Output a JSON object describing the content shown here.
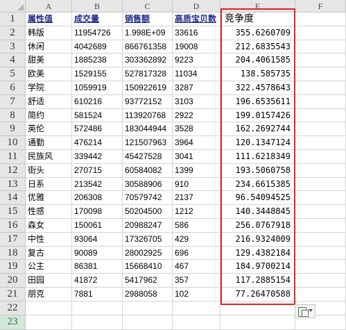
{
  "columns": [
    "A",
    "B",
    "C",
    "D",
    "E",
    "F"
  ],
  "rows": [
    "1",
    "2",
    "3",
    "4",
    "5",
    "6",
    "7",
    "8",
    "9",
    "10",
    "11",
    "12",
    "13",
    "14",
    "15",
    "16",
    "17",
    "18",
    "19",
    "20",
    "21",
    "22",
    "23"
  ],
  "headers": {
    "a": "属性值",
    "b": "成交量",
    "c": "销售额",
    "d": "高质宝贝数",
    "e": "竞争度"
  },
  "data": [
    {
      "a": "韩版",
      "b": "11954726",
      "c": "1.998E+09",
      "d": "33616",
      "e": "355.6260709"
    },
    {
      "a": "休闲",
      "b": "4042689",
      "c": "866761358",
      "d": "19008",
      "e": "212.6835543"
    },
    {
      "a": "甜美",
      "b": "1885238",
      "c": "303362892",
      "d": "9223",
      "e": "204.4061585"
    },
    {
      "a": "欧美",
      "b": "1529155",
      "c": "527817328",
      "d": "11034",
      "e": "138.585735"
    },
    {
      "a": "学院",
      "b": "1059919",
      "c": "150922619",
      "d": "3287",
      "e": "322.4578643"
    },
    {
      "a": "舒适",
      "b": "610216",
      "c": "93772152",
      "d": "3103",
      "e": "196.6535611"
    },
    {
      "a": "简约",
      "b": "581524",
      "c": "113920768",
      "d": "2922",
      "e": "199.0157426"
    },
    {
      "a": "英伦",
      "b": "572486",
      "c": "183044944",
      "d": "3528",
      "e": "162.2692744"
    },
    {
      "a": "通勤",
      "b": "476214",
      "c": "121507963",
      "d": "3964",
      "e": "120.1347124"
    },
    {
      "a": "民族风",
      "b": "339442",
      "c": "45427528",
      "d": "3041",
      "e": "111.6218349"
    },
    {
      "a": "街头",
      "b": "270715",
      "c": "60584082",
      "d": "1399",
      "e": "193.5060758"
    },
    {
      "a": "日系",
      "b": "213542",
      "c": "30588906",
      "d": "910",
      "e": "234.6615385"
    },
    {
      "a": "优雅",
      "b": "206308",
      "c": "70579742",
      "d": "2137",
      "e": "96.54094525"
    },
    {
      "a": "性感",
      "b": "170098",
      "c": "50204500",
      "d": "1212",
      "e": "140.3448845"
    },
    {
      "a": "森女",
      "b": "150061",
      "c": "20988247",
      "d": "586",
      "e": "256.0767918"
    },
    {
      "a": "中性",
      "b": "93064",
      "c": "17326705",
      "d": "429",
      "e": "216.9324009"
    },
    {
      "a": "复古",
      "b": "90089",
      "c": "28002925",
      "d": "696",
      "e": "129.4382184"
    },
    {
      "a": "公主",
      "b": "86381",
      "c": "15668410",
      "d": "467",
      "e": "184.9700214"
    },
    {
      "a": "田园",
      "b": "41872",
      "c": "5417962",
      "d": "357",
      "e": "117.2885154"
    },
    {
      "a": "朋克",
      "b": "7881",
      "c": "2988058",
      "d": "102",
      "e": "77.26470588"
    }
  ],
  "icons": {
    "corner": "select-all-triangle-icon",
    "paste_options": "paste-options-icon"
  },
  "colors": {
    "highlight_border": "#e2222a",
    "header_text": "#1f2a8a",
    "selected_row_text": "#217346"
  }
}
